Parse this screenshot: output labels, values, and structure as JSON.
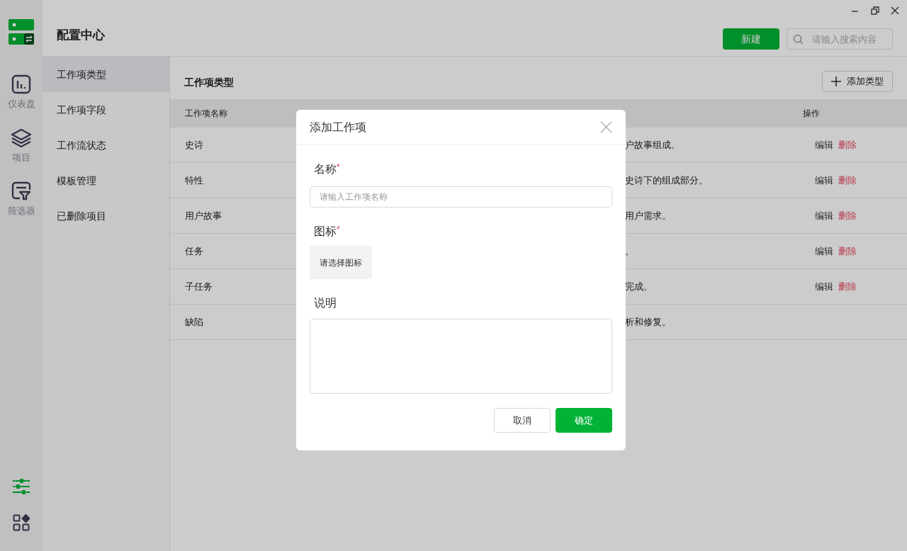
{
  "app_rail": {
    "items": [
      {
        "label": "仪表盘",
        "kind": "dashboard"
      },
      {
        "label": "项目",
        "kind": "layers"
      },
      {
        "label": "筛选器",
        "kind": "filter"
      }
    ]
  },
  "header": {
    "title": "配置中心",
    "new_button": "新建",
    "search": {
      "placeholder": "请输入搜索内容"
    }
  },
  "nav": {
    "items": [
      {
        "label": "工作项类型",
        "selected": true
      },
      {
        "label": "工作项字段",
        "selected": false
      },
      {
        "label": "工作流状态",
        "selected": false
      },
      {
        "label": "模板管理",
        "selected": false
      },
      {
        "label": "已删除项目",
        "selected": false
      }
    ]
  },
  "content": {
    "title": "工作项类型",
    "add_button": "添加类型",
    "table": {
      "columns": [
        "工作项名称",
        "操作"
      ],
      "rows": [
        {
          "name": "史诗",
          "description": "户故事组成。",
          "actions": [
            {
              "label": "编辑",
              "kind": "edit"
            },
            {
              "label": "删除",
              "kind": "delete"
            }
          ]
        },
        {
          "name": "特性",
          "description": "史诗下的组成部分。",
          "actions": [
            {
              "label": "编辑",
              "kind": "edit"
            },
            {
              "label": "删除",
              "kind": "delete"
            }
          ]
        },
        {
          "name": "用户故事",
          "description": "用户需求。",
          "actions": [
            {
              "label": "编辑",
              "kind": "edit"
            },
            {
              "label": "删除",
              "kind": "delete"
            }
          ]
        },
        {
          "name": "任务",
          "description": "。",
          "actions": [
            {
              "label": "编辑",
              "kind": "edit"
            },
            {
              "label": "删除",
              "kind": "delete"
            }
          ]
        },
        {
          "name": "子任务",
          "description": "完成。",
          "actions": [
            {
              "label": "编辑",
              "kind": "edit"
            },
            {
              "label": "删除",
              "kind": "delete"
            }
          ]
        },
        {
          "name": "缺陷",
          "description": "析和修复。"
        }
      ]
    }
  },
  "dialog": {
    "title": "添加工作项",
    "fields": [
      {
        "kind": "text",
        "label": "名称",
        "required_mark": "*",
        "placeholder": "请输入工作项名称"
      },
      {
        "kind": "icon_picker",
        "label": "图标",
        "required_mark": "*",
        "button": "请选择图标"
      },
      {
        "kind": "textarea",
        "label": "说明"
      }
    ],
    "buttons": [
      {
        "label": "取消",
        "kind": "secondary"
      },
      {
        "label": "确定",
        "kind": "primary"
      }
    ]
  }
}
